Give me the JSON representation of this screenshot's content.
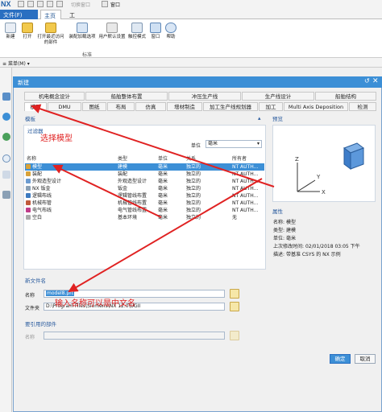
{
  "app": {
    "logo": "NX",
    "title_hint": "切换窗口",
    "window_menu": "窗口"
  },
  "ribbon": {
    "tabs": [
      {
        "label": "文件(F)"
      },
      {
        "label": "主页"
      },
      {
        "label": "工具"
      }
    ],
    "buttons": [
      {
        "label": "新建",
        "icon": "new-file-icon"
      },
      {
        "label": "打开",
        "icon": "open-folder-icon"
      },
      {
        "label": "打开最近访问的部件",
        "icon": "recent-parts-icon"
      },
      {
        "label": "装配加载选项",
        "icon": "assembly-load-icon"
      },
      {
        "label": "用户默认设置",
        "icon": "user-defaults-icon"
      },
      {
        "label": "触控模式",
        "icon": "touch-mode-icon"
      },
      {
        "label": "窗口",
        "icon": "window-icon"
      },
      {
        "label": "帮助",
        "icon": "help-icon"
      }
    ],
    "group_label": "标准",
    "menu_button": "菜单(M)"
  },
  "dialog": {
    "title": "新建",
    "top_tabs": [
      "机电概念设计",
      "船舶整体布置",
      "冲压生产线",
      "生产线设计",
      "船舶结构"
    ],
    "tabs": [
      "模型",
      "DMU",
      "图纸",
      "布局",
      "仿真",
      "增材制造",
      "加工生产线规划器",
      "加工",
      "Multi Axis Deposition",
      "检测"
    ],
    "templates_section": "模板",
    "filter_label": "过滤器",
    "unit_label": "单位",
    "unit_value": "毫米",
    "columns": [
      "名称",
      "类型",
      "单位",
      "关系",
      "所有者"
    ],
    "rows": [
      {
        "name": "模型",
        "type": "建模",
        "unit": "毫米",
        "relation": "独立的",
        "owner": "NT AUTH...",
        "selected": true,
        "icon_color": "#d8a23a"
      },
      {
        "name": "装配",
        "type": "装配",
        "unit": "毫米",
        "relation": "独立的",
        "owner": "NT AUTH...",
        "selected": false,
        "icon_color": "#d8a23a"
      },
      {
        "name": "外观造型设计",
        "type": "外观造型设计",
        "unit": "毫米",
        "relation": "独立的",
        "owner": "NT AUTH...",
        "selected": false,
        "icon_color": "#6b9bd1"
      },
      {
        "name": "NX 钣金",
        "type": "钣金",
        "unit": "毫米",
        "relation": "独立的",
        "owner": "NT AUTH...",
        "selected": false,
        "icon_color": "#8aa0b5"
      },
      {
        "name": "逻辑布线",
        "type": "逻辑管线布置",
        "unit": "毫米",
        "relation": "独立的",
        "owner": "NT AUTH...",
        "selected": false,
        "icon_color": "#3c7ac0"
      },
      {
        "name": "机械布管",
        "type": "机械管线布置",
        "unit": "毫米",
        "relation": "独立的",
        "owner": "NT AUTH...",
        "selected": false,
        "icon_color": "#c05a3c"
      },
      {
        "name": "电气布线",
        "type": "电气管线布置",
        "unit": "毫米",
        "relation": "独立的",
        "owner": "NT AUTH...",
        "selected": false,
        "icon_color": "#c03c8a"
      },
      {
        "name": "空白",
        "type": "基本环境",
        "unit": "毫米",
        "relation": "独立的",
        "owner": "无",
        "selected": false,
        "icon_color": "#aaaaaa"
      }
    ],
    "preview_section": "预览",
    "properties_section": "属性",
    "properties": [
      {
        "k": "名称",
        "v": "模型"
      },
      {
        "k": "类型",
        "v": "建模"
      },
      {
        "k": "单位",
        "v": "毫米"
      },
      {
        "k": "上次修改时间",
        "v": "02/01/2018 03:05 下午"
      },
      {
        "k": "描述",
        "v": "带基准 CSYS 的 NX 示例"
      }
    ],
    "new_file_section": "新文件名",
    "name_label": "名称",
    "name_value": "model8.prt",
    "folder_label": "文件夹",
    "folder_value": "D:\\Program Files\\Siemens\\NX 12.0\\UGII",
    "ref_parts_section": "要引用的部件",
    "ref_name_label": "名称",
    "ok_label": "确定",
    "cancel_label": "取消"
  },
  "annotations": {
    "select_model": "选择模型",
    "enter_name": "输入名称可以是中文名"
  },
  "colors": {
    "accent": "#3c8fd6",
    "file_tab": "#2a6fc1",
    "annotation_red": "#e02222"
  }
}
